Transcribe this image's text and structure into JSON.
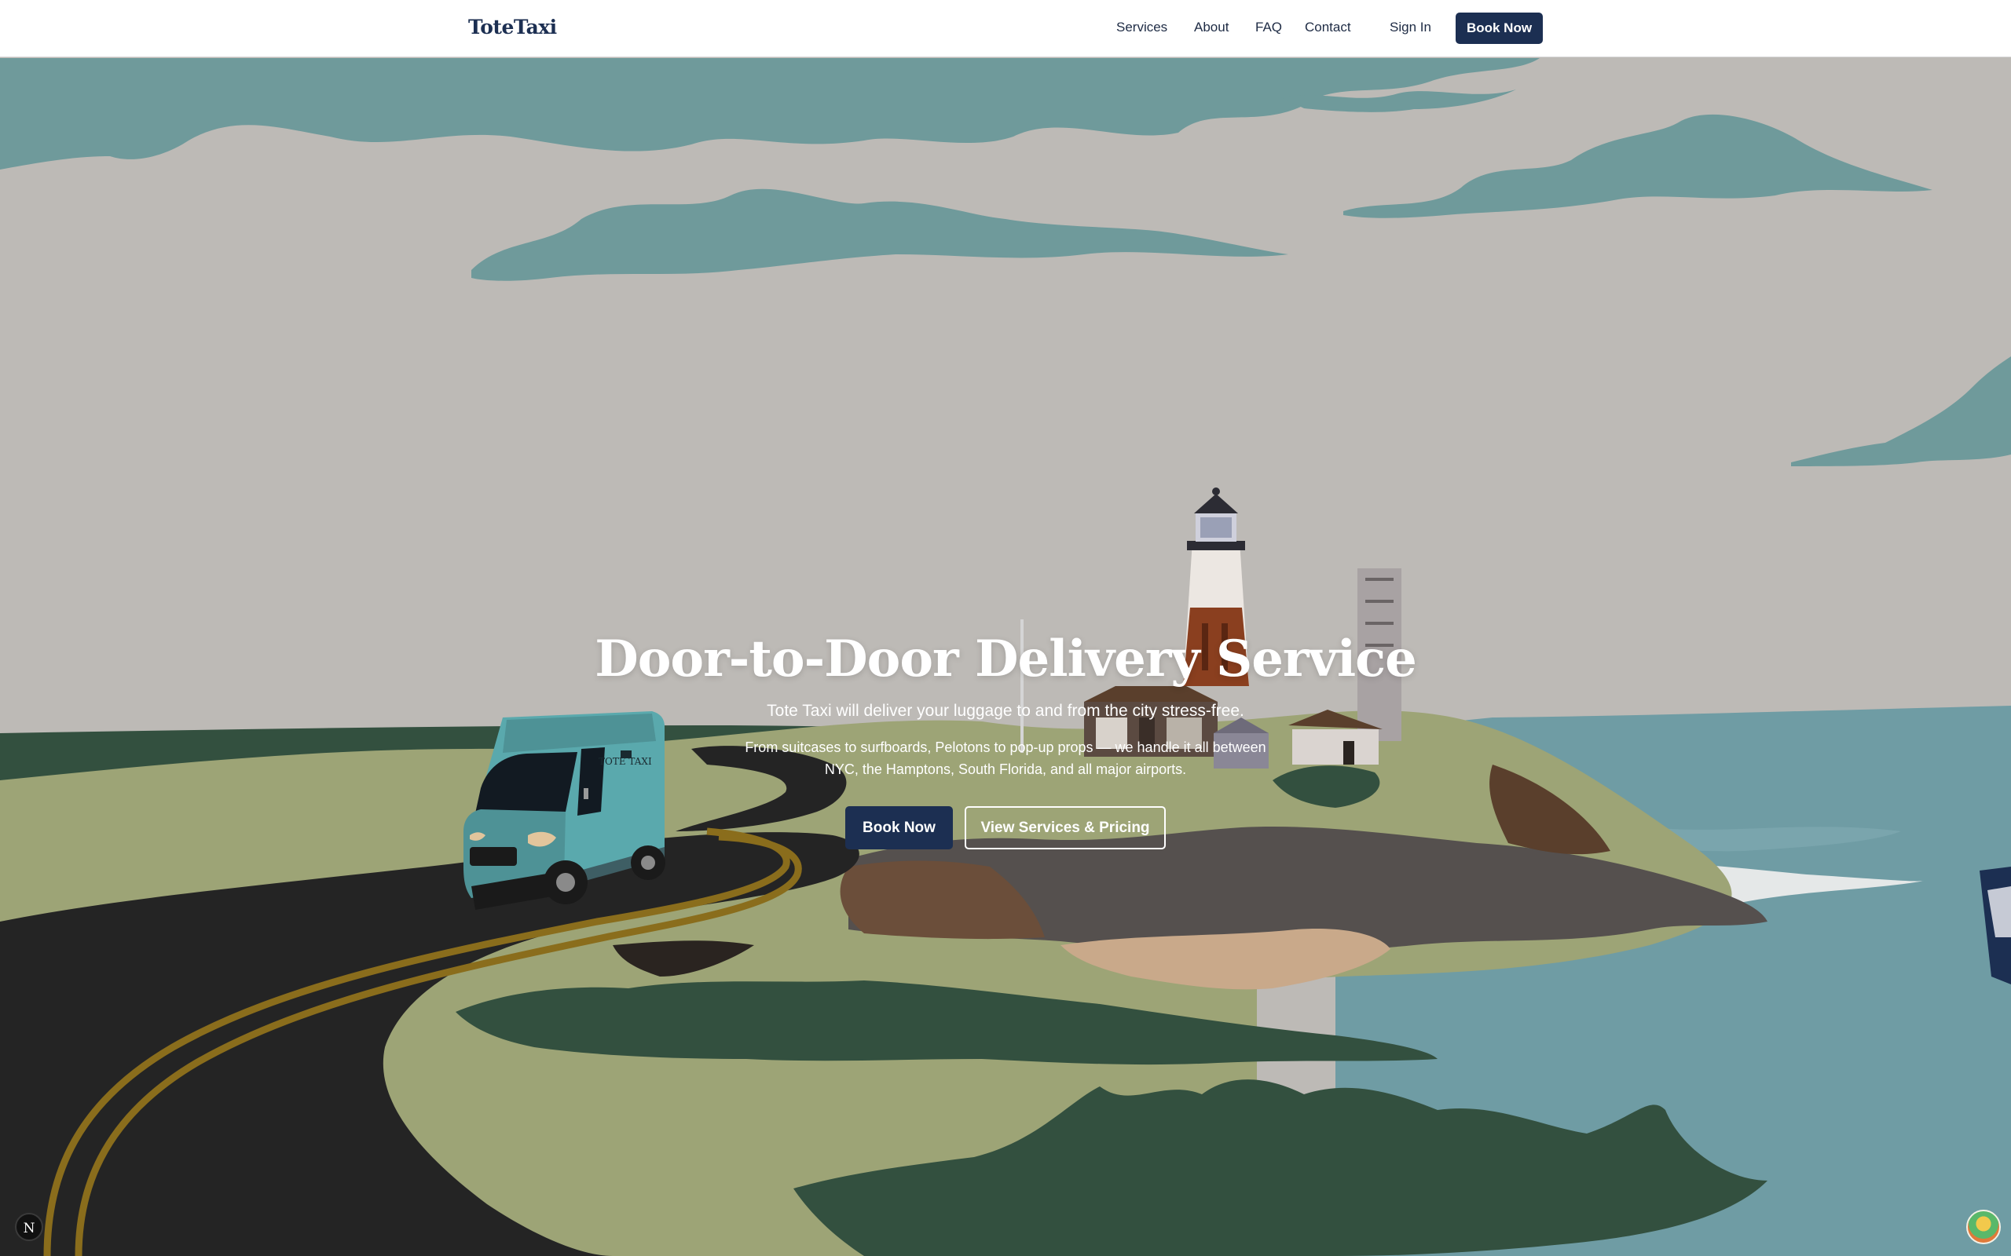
{
  "navbar": {
    "brand": "ToteTaxi",
    "links": [
      "Services",
      "About",
      "FAQ",
      "Contact"
    ],
    "sign_in": "Sign In",
    "book_now": "Book Now"
  },
  "hero": {
    "title": "Door-to-Door Delivery Service",
    "subtitle": "Tote Taxi will deliver your luggage to and from the city stress-free.",
    "description": "From suitcases to surfboards, Pelotons to pop-up props — we handle it all between NYC, the Hamptons, South Florida, and all major airports.",
    "primary_button": "Book Now",
    "secondary_button": "View Services & Pricing",
    "van_text": "TOTE TAXI"
  },
  "dev_badge": "N",
  "colors": {
    "brand_navy": "#1c2f52",
    "sky": "#bdbab6",
    "clouds": "#6f9a9b",
    "grass": "#9da476",
    "dark_grass": "#33503f",
    "road": "#242424",
    "road_lines": "#8a6d1c",
    "water": "#6f9ca4",
    "van": "#5aa9ad"
  }
}
